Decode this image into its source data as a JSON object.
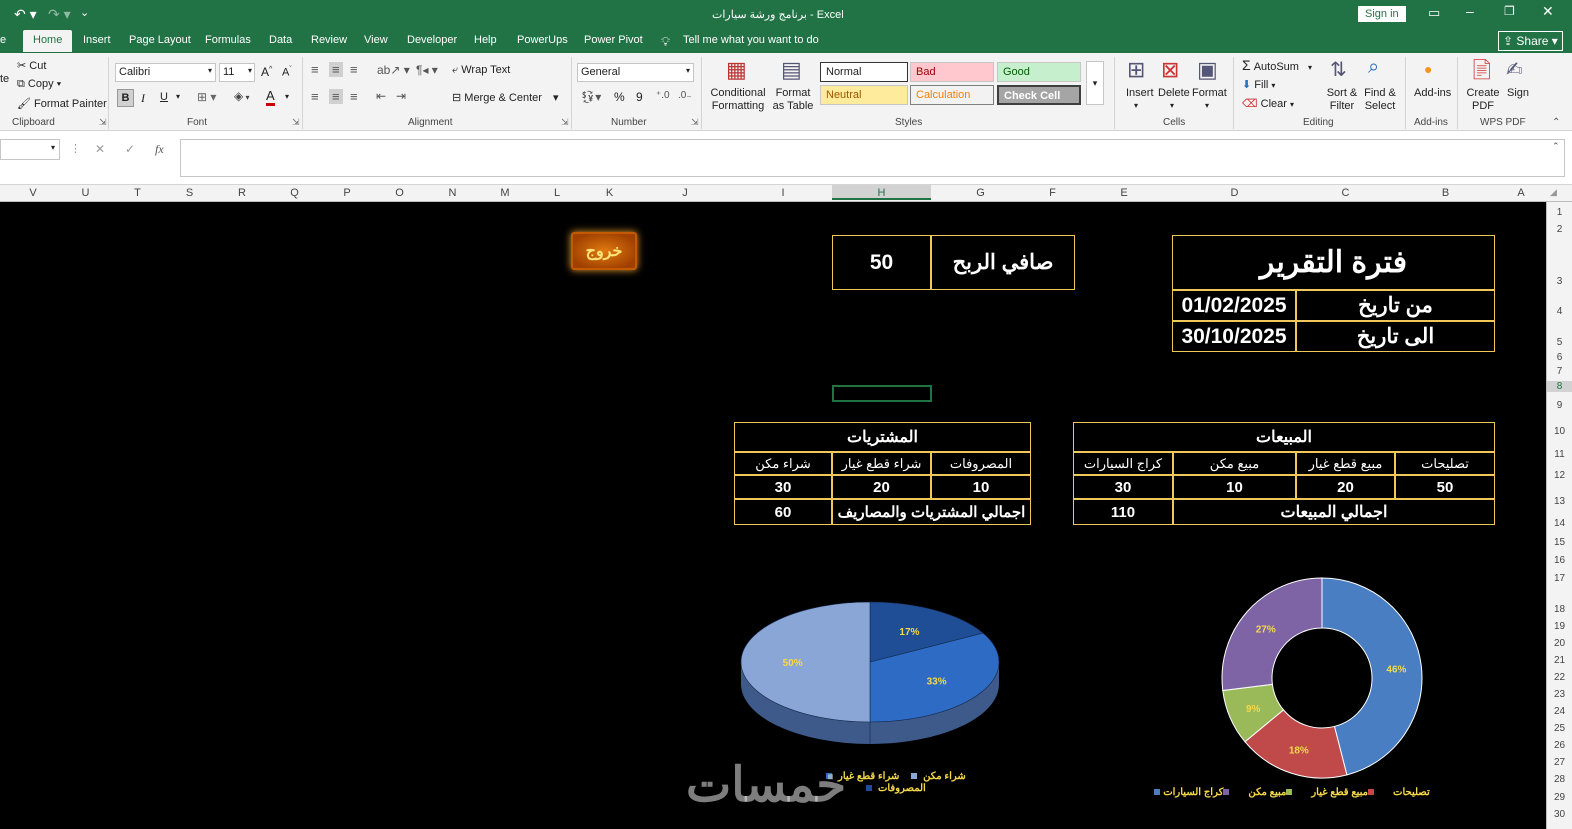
{
  "window": {
    "title": "برنامج ورشة سيارات  -  Excel",
    "sign_in": "Sign in",
    "share": "Share"
  },
  "tabs": [
    {
      "label": "Home"
    },
    {
      "label": "Insert"
    },
    {
      "label": "Page Layout"
    },
    {
      "label": "Formulas"
    },
    {
      "label": "Data"
    },
    {
      "label": "Review"
    },
    {
      "label": "View"
    },
    {
      "label": "Developer"
    },
    {
      "label": "Help"
    },
    {
      "label": "PowerUps"
    },
    {
      "label": "Power Pivot"
    }
  ],
  "tell_me": "Tell me what you want to do",
  "ribbon": {
    "clipboard": {
      "cut": "Cut",
      "copy": "Copy",
      "painter": "Format Painter",
      "label": "Clipboard"
    },
    "font": {
      "name": "Calibri",
      "size": "11",
      "label": "Font",
      "bold": "B",
      "italic": "I",
      "underline": "U"
    },
    "alignment": {
      "wrap": "Wrap Text",
      "merge": "Merge & Center",
      "label": "Alignment"
    },
    "number": {
      "format": "General",
      "label": "Number",
      "percent": "%",
      "comma": "9"
    },
    "styles": {
      "conditional": "Conditional Formatting",
      "format_table": "Format as Table",
      "normal": "Normal",
      "bad": "Bad",
      "good": "Good",
      "neutral": "Neutral",
      "calculation": "Calculation",
      "check": "Check Cell",
      "label": "Styles"
    },
    "cells": {
      "insert": "Insert",
      "delete": "Delete",
      "format": "Format",
      "label": "Cells"
    },
    "editing": {
      "autosum": "AutoSum",
      "fill": "Fill",
      "clear": "Clear",
      "sort": "Sort & Filter",
      "find": "Find & Select",
      "label": "Editing"
    },
    "addins": {
      "addins": "Add-ins",
      "label": "Add-ins"
    },
    "wps": {
      "create": "Create PDF",
      "sign": "Sign",
      "label": "WPS PDF"
    }
  },
  "formula_bar": {
    "name_box": "",
    "fx": "fx",
    "value": ""
  },
  "columns": [
    "V",
    "U",
    "T",
    "S",
    "R",
    "Q",
    "P",
    "O",
    "N",
    "M",
    "L",
    "K",
    "J",
    "I",
    "H",
    "G",
    "F",
    "E",
    "D",
    "C",
    "B",
    "A"
  ],
  "rows": [
    "1",
    "2",
    "3",
    "4",
    "5",
    "6",
    "7",
    "8",
    "9",
    "10",
    "11",
    "12",
    "13",
    "14",
    "15",
    "16",
    "17",
    "18",
    "19",
    "20",
    "21",
    "22",
    "23",
    "24",
    "25",
    "26",
    "27",
    "28",
    "29",
    "30"
  ],
  "sheet": {
    "exit_button": "خروج",
    "report_period": {
      "title": "فترة التقرير",
      "from_label": "من تاريخ",
      "from_value": "01/02/2025",
      "to_label": "الى تاريخ",
      "to_value": "30/10/2025"
    },
    "net_profit": {
      "label": "صافي الربح",
      "value": "50"
    },
    "sales": {
      "title": "المبيعات",
      "headers": [
        "تصليحات",
        "مبيع قطع غيار",
        "مبيع مكن",
        "كراج السيارات"
      ],
      "values": [
        "50",
        "20",
        "10",
        "30"
      ],
      "total_label": "اجمالي المبيعات",
      "total_value": "110"
    },
    "purchases": {
      "title": "المشتريات",
      "headers": [
        "المصروفات",
        "شراء قطع غيار",
        "شراء مكن"
      ],
      "values": [
        "10",
        "20",
        "30"
      ],
      "total_label": "اجمالي المشتريات والمصاريف",
      "total_value": "60"
    }
  },
  "chart_data": [
    {
      "type": "pie",
      "subtype": "3d",
      "categories": [
        "المصروفات",
        "شراء قطع غيار",
        "شراء مكن"
      ],
      "values": [
        17,
        33,
        50
      ],
      "labels": [
        "17%",
        "33%",
        "50%"
      ],
      "colors": [
        "#1f4e96",
        "#2e6bc4",
        "#8aa6d6"
      ],
      "legend_position": "bottom"
    },
    {
      "type": "pie",
      "subtype": "doughnut",
      "categories": [
        "تصليحات",
        "مبيع قطع غيار",
        "مبيع مكن",
        "كراج السيارات"
      ],
      "values": [
        46,
        18,
        9,
        27
      ],
      "labels": [
        "46%",
        "18%",
        "9%",
        "27%"
      ],
      "colors": [
        "#4a7ec2",
        "#c0494a",
        "#9aba59",
        "#7e64a4"
      ],
      "legend_position": "bottom"
    }
  ],
  "watermark": "خمسات"
}
